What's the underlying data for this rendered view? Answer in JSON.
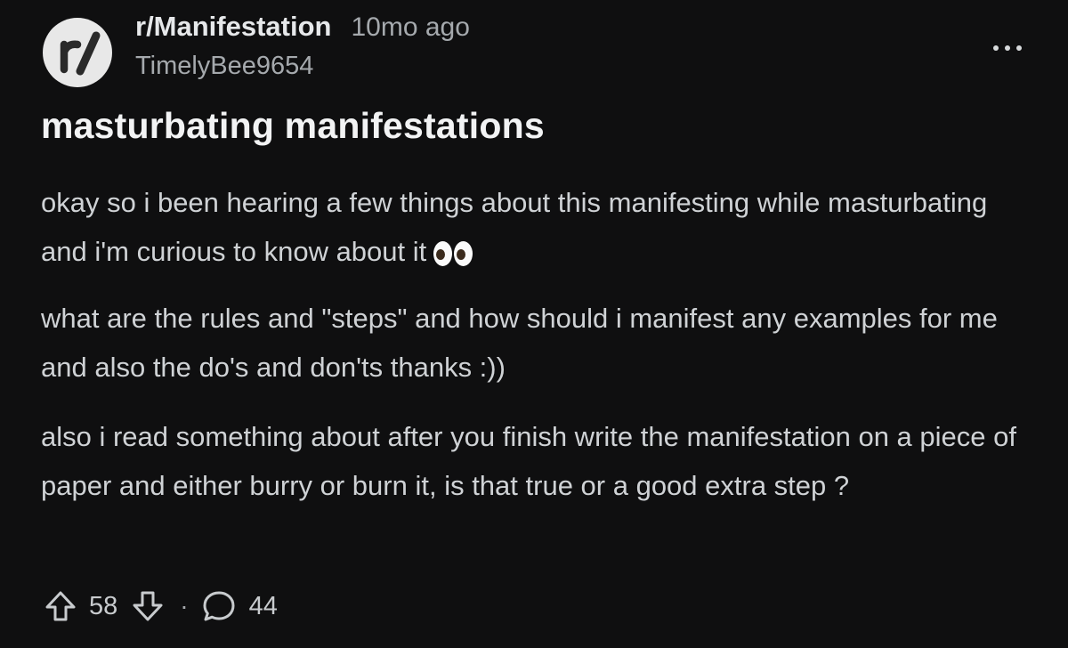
{
  "post": {
    "subreddit": "r/Manifestation",
    "avatar_text": "r/",
    "time_ago": "10mo ago",
    "author": "TimelyBee9654",
    "title": "masturbating manifestations",
    "paragraphs": [
      "okay so i been hearing a few things about this manifesting while masturbating and i'm curious to know about it",
      "what are the rules and \"steps\" and how should i manifest any examples for me and also the do's and don'ts thanks :))",
      "also i read something about after you finish write the manifestation on a piece of paper and either burry or burn it, is that true or a good extra step ?"
    ],
    "emoji_icon": "eyes-emoji-icon",
    "upvotes": "58",
    "separator": "·",
    "comments": "44"
  },
  "icons": {
    "more": "more-options-icon",
    "upvote": "upvote-arrow-icon",
    "downvote": "downvote-arrow-icon",
    "comment": "comment-bubble-icon"
  },
  "colors": {
    "background": "#0f0f10",
    "text": "#d7dadc",
    "muted": "#a5a9ad",
    "avatar_bg": "#e8e8e8"
  }
}
